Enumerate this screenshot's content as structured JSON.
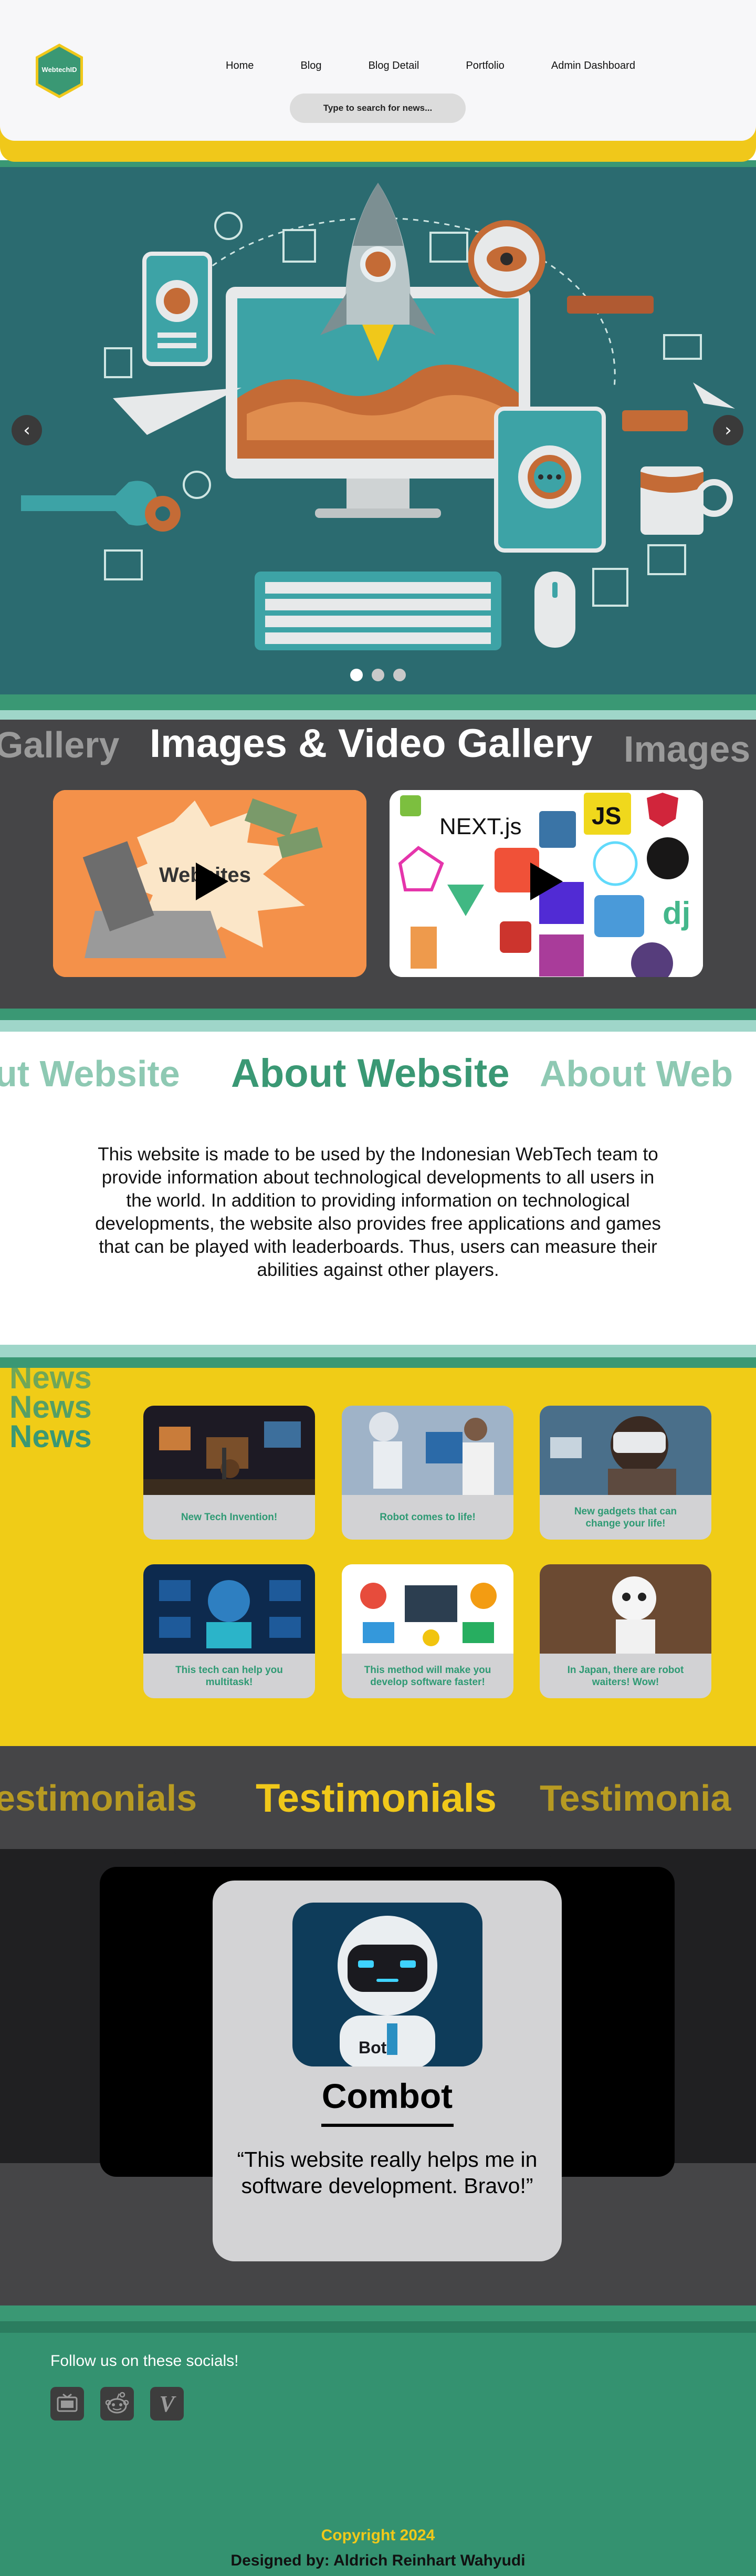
{
  "header": {
    "logo_text": "WebtechID",
    "nav": [
      "Home",
      "Blog",
      "Blog Detail",
      "Portfolio",
      "Admin Dashboard"
    ],
    "search_placeholder": "Type to search for news..."
  },
  "hero": {
    "prev_icon": "chevron-left-icon",
    "next_icon": "chevron-right-icon",
    "slides": 3,
    "active_slide": 1
  },
  "gallery": {
    "title": "Images & Video Gallery",
    "title_left_fragment": "Gallery",
    "title_right_fragment": "Images",
    "videos": [
      {
        "label": "Websites",
        "icon": "play-icon"
      },
      {
        "label": "NEXT.js",
        "icon": "play-icon"
      }
    ]
  },
  "about": {
    "title": "About Website",
    "title_left_fragment": "ut Website",
    "title_right_fragment": "About Web",
    "body": "This website is made to be used by the Indonesian WebTech team to provide information about technological developments to all users in the world. In addition to providing information on technological developments, the website also provides free applications and games that can be played with leaderboards. Thus, users can measure their abilities against other players."
  },
  "news": {
    "title_lines": [
      "News",
      "News",
      "News"
    ],
    "items": [
      {
        "caption": "New Tech Invention!"
      },
      {
        "caption": "Robot comes to life!"
      },
      {
        "caption": "New gadgets that can change your life!"
      },
      {
        "caption": "This tech can help you multitask!"
      },
      {
        "caption": "This method will make you develop software faster!"
      },
      {
        "caption": "In Japan, there are robot waiters! Wow!"
      }
    ]
  },
  "testimonials": {
    "title": "Testimonials",
    "title_left_fragment": "estimonials",
    "title_right_fragment": "Testimonia",
    "name": "Combot",
    "avatar_badge": "Bot",
    "quote": "“This website really helps me in software development. Bravo!”"
  },
  "footer": {
    "follow_text": "Follow us on these socials!",
    "socials": [
      "tv-icon",
      "reddit-icon",
      "vimeo-icon"
    ],
    "vimeo_glyph": "V",
    "copyright": "Copyright 2024",
    "designed_by": "Designed by: Aldrich Reinhart Wahyudi"
  },
  "colors": {
    "brand_green": "#3a9874",
    "brand_yellow": "#f0c81a",
    "dark_gray": "#454547",
    "light_teal": "#9fd6c9"
  }
}
